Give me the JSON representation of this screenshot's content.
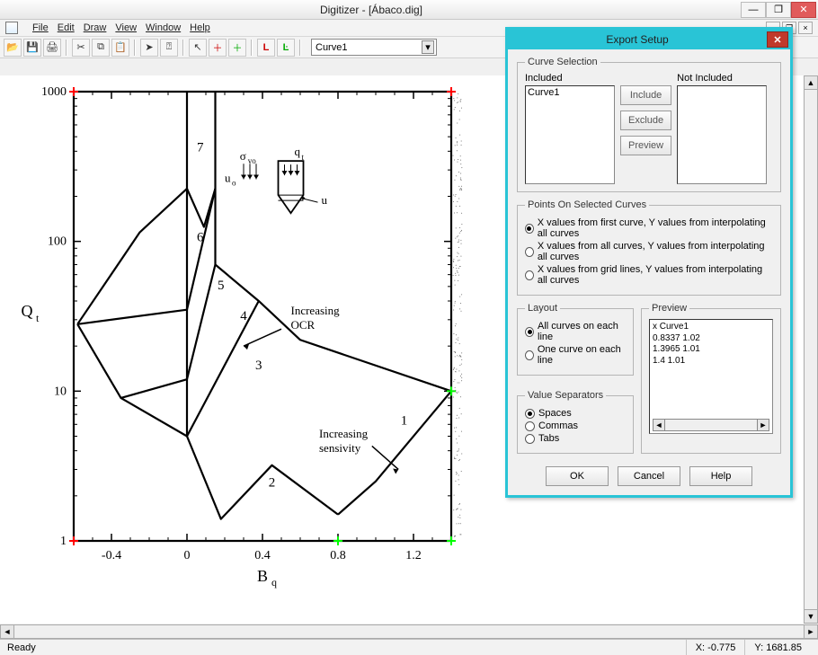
{
  "app_title": "Digitizer - [Ábaco.dig]",
  "menu": {
    "file": "File",
    "edit": "Edit",
    "draw": "Draw",
    "view": "View",
    "window": "Window",
    "help": "Help"
  },
  "toolbar": {
    "curve_selected": "Curve1"
  },
  "chart_data": {
    "type": "line",
    "title": "",
    "xlabel": "B_q",
    "ylabel": "Q_t",
    "xscale": "linear",
    "yscale": "log",
    "xlim": [
      -0.6,
      1.4
    ],
    "ylim": [
      1,
      1000
    ],
    "xticks": [
      -0.4,
      0,
      0.4,
      0.8,
      1.2
    ],
    "yticks": [
      1,
      10,
      100,
      1000
    ],
    "region_labels": [
      "1",
      "2",
      "3",
      "4",
      "5",
      "6",
      "7"
    ],
    "annotations": [
      "Increasing OCR",
      "Increasing sensivity",
      "σ_vo",
      "u_o",
      "q_t",
      "u"
    ],
    "axis_markers": [
      {
        "pos": "top-left",
        "color": "red"
      },
      {
        "pos": "top-right",
        "color": "red"
      },
      {
        "pos": "bottom-left",
        "color": "red"
      },
      {
        "pos": "bottom-right",
        "color": "lime"
      },
      {
        "pos": "mid-right",
        "color": "lime"
      },
      {
        "pos": "bottom-mid",
        "color": "lime"
      }
    ],
    "boundaries": [
      {
        "name": "outer_frame",
        "points": [
          [
            -0.6,
            1
          ],
          [
            -0.6,
            1000
          ],
          [
            1.4,
            1000
          ],
          [
            1.4,
            1
          ],
          [
            -0.6,
            1
          ]
        ]
      },
      {
        "name": "vertical_at_zero_upper",
        "points": [
          [
            0,
            5
          ],
          [
            0,
            1000
          ]
        ]
      },
      {
        "name": "zone6_7_right",
        "points": [
          [
            0.15,
            1000
          ],
          [
            0.15,
            70
          ]
        ]
      },
      {
        "name": "top_descent_from_right",
        "points": [
          [
            0.15,
            70
          ],
          [
            0.38,
            40
          ],
          [
            0.6,
            22
          ],
          [
            1.4,
            10
          ]
        ]
      },
      {
        "name": "zone5_6",
        "points": [
          [
            0.15,
            225
          ],
          [
            0,
            35
          ]
        ]
      },
      {
        "name": "zone4_5",
        "points": [
          [
            0.15,
            70
          ],
          [
            0,
            12
          ]
        ]
      },
      {
        "name": "zone3_4",
        "points": [
          [
            0.38,
            40
          ],
          [
            0,
            5
          ]
        ]
      },
      {
        "name": "tail_lower_right",
        "points": [
          [
            1.4,
            10
          ],
          [
            1.0,
            2.5
          ],
          [
            0.8,
            1.5
          ]
        ]
      },
      {
        "name": "bottom_valley",
        "points": [
          [
            0,
            5
          ],
          [
            0.18,
            1.4
          ],
          [
            0.45,
            3.2
          ],
          [
            0.8,
            1.5
          ]
        ]
      },
      {
        "name": "left_lobe_upper",
        "points": [
          [
            0,
            225
          ],
          [
            -0.25,
            115
          ],
          [
            -0.58,
            28
          ]
        ]
      },
      {
        "name": "left_lobe_mid",
        "points": [
          [
            0,
            35
          ],
          [
            -0.58,
            28
          ]
        ]
      },
      {
        "name": "left_lobe_lower",
        "points": [
          [
            0,
            12
          ],
          [
            -0.35,
            9
          ]
        ]
      },
      {
        "name": "left_lobe_bottom",
        "points": [
          [
            -0.58,
            28
          ],
          [
            -0.35,
            9
          ],
          [
            0,
            5
          ]
        ]
      },
      {
        "name": "zone7_inner",
        "points": [
          [
            0,
            225
          ],
          [
            0.09,
            125
          ],
          [
            0.15,
            225
          ]
        ]
      }
    ]
  },
  "export_dialog": {
    "title": "Export Setup",
    "curve_selection": {
      "legend": "Curve Selection",
      "included_label": "Included",
      "not_included_label": "Not Included",
      "included_items": [
        "Curve1"
      ],
      "not_included_items": [],
      "include_btn": "Include",
      "exclude_btn": "Exclude",
      "preview_btn": "Preview"
    },
    "points_on_selected": {
      "legend": "Points On Selected Curves",
      "options": [
        "X values from first curve, Y values from interpolating all curves",
        "X values from all curves, Y values from interpolating all curves",
        "X values from grid lines, Y values from interpolating all curves"
      ],
      "selected_index": 0
    },
    "layout": {
      "legend": "Layout",
      "options": [
        "All curves on each line",
        "One curve on each line"
      ],
      "selected_index": 0
    },
    "value_separators": {
      "legend": "Value Separators",
      "options": [
        "Spaces",
        "Commas",
        "Tabs"
      ],
      "selected_index": 0
    },
    "preview": {
      "legend": "Preview",
      "lines": [
        "x Curve1",
        "0.8337 1.02",
        "1.3965 1.01",
        "1.4 1.01"
      ]
    },
    "buttons": {
      "ok": "OK",
      "cancel": "Cancel",
      "help": "Help"
    }
  },
  "status": {
    "ready": "Ready",
    "x_label": "X:",
    "x_value": "-0.775",
    "y_label": "Y:",
    "y_value": "1681.85"
  }
}
